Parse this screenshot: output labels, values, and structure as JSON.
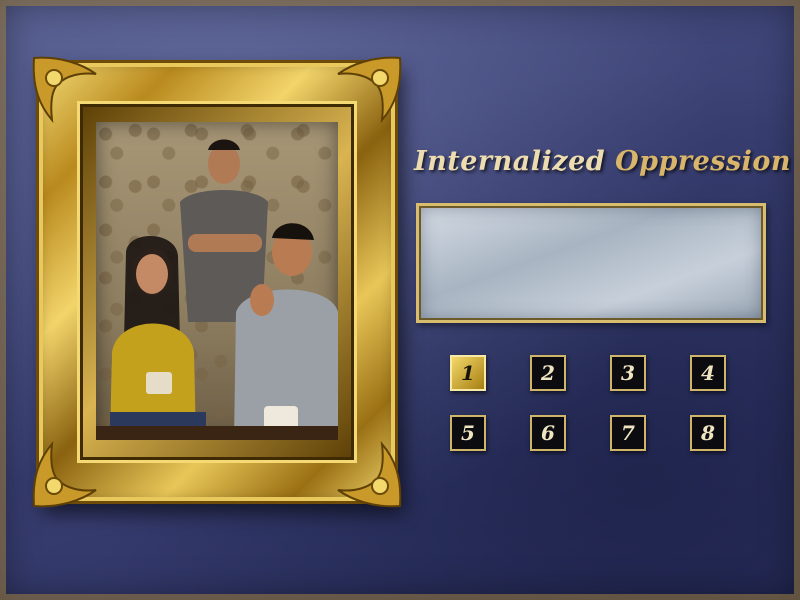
{
  "title": {
    "part1": "Internalized ",
    "part2": "Oppression"
  },
  "display": {
    "text": ""
  },
  "buttons": [
    {
      "label": "1",
      "active": true
    },
    {
      "label": "2",
      "active": false
    },
    {
      "label": "3",
      "active": false
    },
    {
      "label": "4",
      "active": false
    },
    {
      "label": "5",
      "active": false
    },
    {
      "label": "6",
      "active": false
    },
    {
      "label": "7",
      "active": false
    },
    {
      "label": "8",
      "active": false
    }
  ],
  "colors": {
    "background": "#3a4073",
    "frame_gold": "#d4a93a",
    "button_bg": "#0c0c10",
    "button_active": "#d9b440",
    "title_gold": "#d8b56a"
  },
  "icons": {
    "photo": "family-photo"
  }
}
